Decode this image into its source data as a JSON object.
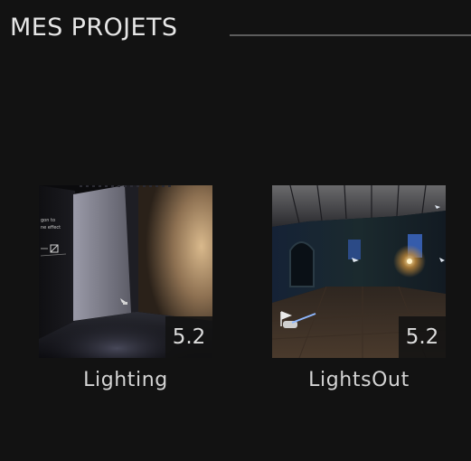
{
  "section": {
    "title": "MES PROJETS"
  },
  "projects": [
    {
      "name": "Lighting",
      "engine_version": "5.2",
      "thumbnail_icon": "dark-room-spotlight-thumbnail"
    },
    {
      "name": "LightsOut",
      "engine_version": "5.2",
      "thumbnail_icon": "night-hall-interior-thumbnail"
    }
  ],
  "colors": {
    "background": "#121212",
    "rule": "#5c5c5c",
    "text": "#d4d4d4"
  }
}
